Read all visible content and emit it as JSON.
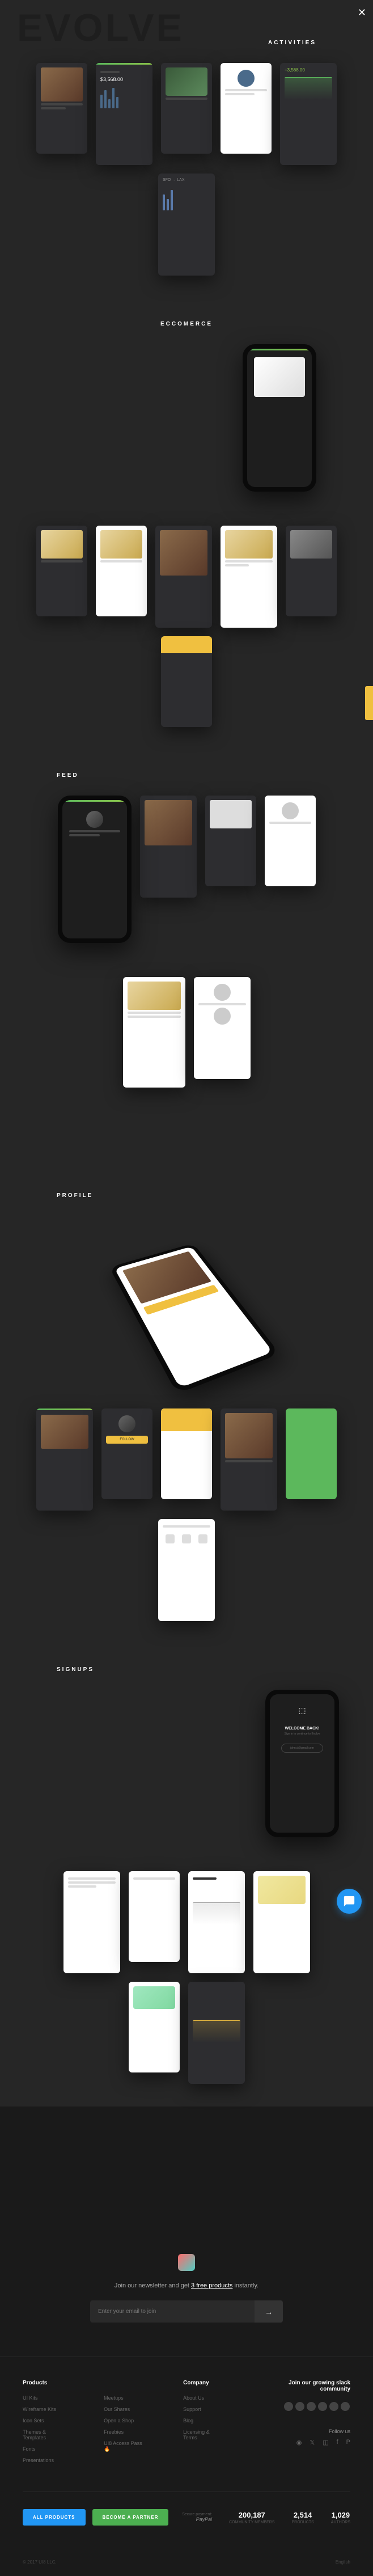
{
  "hero_bg": "EVOLVE",
  "sections": {
    "activities": "ACTIVITIES",
    "ecommerce": "ECCOMERCE",
    "feed": "FEED",
    "profile": "PROFILE",
    "signups": "SIGNUPS"
  },
  "mockup_values": {
    "balance1": "$3,568.00",
    "balance2": "+3,568.00",
    "route": "SFO → LAX",
    "welcome": "WELCOME BACK!",
    "welcome_sub": "Sign in to continue to Evolve",
    "email_sample": "john.d@gmail.com"
  },
  "newsletter": {
    "text_pre": "Join our newsletter and get ",
    "text_link": "3 free products",
    "text_post": " instantly.",
    "placeholder": "Enter your email to join"
  },
  "footer": {
    "products": {
      "title": "Products",
      "links": [
        "UI Kits",
        "Wireframe Kits",
        "Icon Sets",
        "Themes & Templates",
        "Fonts",
        "Presentations"
      ]
    },
    "company": {
      "title": "Company",
      "links": [
        "About Us",
        "Support",
        "Blog",
        "Licensing & Terms"
      ]
    },
    "extra": {
      "links": [
        "Meetups",
        "Our Shares",
        "Open a Shop",
        "Freebies",
        "UI8 Access Pass 🔥"
      ]
    },
    "slack": {
      "title": "Join our growing slack community",
      "follow": "Follow us"
    }
  },
  "buttons": {
    "all_products": "ALL PRODUCTS",
    "become_partner": "BECOME A PARTNER"
  },
  "payment": {
    "label": "Secure payment:",
    "provider": "PayPal"
  },
  "stats": [
    {
      "num": "200,187",
      "label": "COMMUNITY MEMBERS"
    },
    {
      "num": "2,514",
      "label": "PRODUCTS"
    },
    {
      "num": "1,029",
      "label": "AUTHORS"
    }
  ],
  "copyright": {
    "left": "© 2017 UI8 LLC.",
    "right": "English"
  }
}
